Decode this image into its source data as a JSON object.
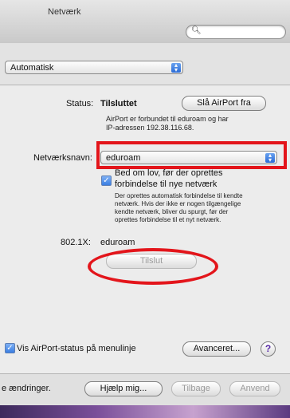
{
  "window": {
    "title": "Netværk"
  },
  "search": {
    "placeholder": "",
    "icon": "magnifier"
  },
  "location": {
    "value": "Automatisk"
  },
  "status": {
    "label": "Status:",
    "value": "Tilsluttet",
    "toggle_button": "Slå AirPort fra",
    "description_lines": [
      "AirPort er forbundet til eduroam og har",
      "IP-adressen 192.38.116.68."
    ]
  },
  "network": {
    "label": "Netværksnavn:",
    "value": "eduroam",
    "ask_checkbox": {
      "checked": true,
      "label_lines": [
        "Bed om lov, før der oprettes",
        "forbindelse til nye netværk"
      ],
      "description_lines": [
        "Der oprettes automatisk forbindelse til kendte",
        "netværk. Hvis der ikke er nogen tilgængelige",
        "kendte netværk, bliver du spurgt, før der",
        "oprettes forbindelse til et nyt netværk."
      ]
    }
  },
  "auth": {
    "label": "802.1X:",
    "value": "eduroam",
    "connect_button": "Tilslut"
  },
  "menubar_option": {
    "checked": true,
    "label": "Vis AirPort-status på menulinje"
  },
  "advanced_button": "Avanceret...",
  "help_symbol": "?",
  "footer": {
    "text": "e ændringer.",
    "help_button": "Hjælp mig...",
    "back_button": "Tilbage",
    "apply_button": "Anvend"
  },
  "annotation_color": "#e3151b"
}
